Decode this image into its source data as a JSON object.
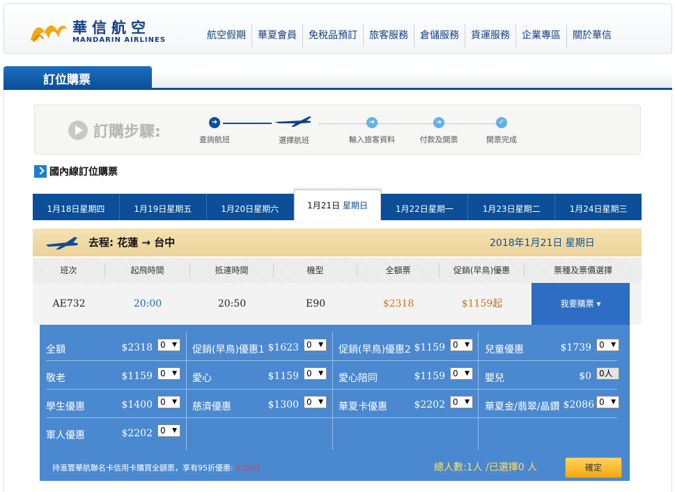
{
  "brand": {
    "name_cn": "華信航空",
    "name_en": "MANDARIN AIRLINES",
    "color": "#123f86"
  },
  "nav": [
    "航空假期",
    "華夏會員",
    "免稅品預訂",
    "旅客服務",
    "倉儲服務",
    "貨運服務",
    "企業專區",
    "關於華信"
  ],
  "section_title": "訂位購票",
  "steps": {
    "title": "訂購步驟:",
    "items": [
      {
        "label": "查詢航班",
        "state": "done"
      },
      {
        "label": "選擇航班",
        "state": "current"
      },
      {
        "label": "輸入旅客資料",
        "state": "todo"
      },
      {
        "label": "付款及開票",
        "state": "todo"
      },
      {
        "label": "開票完成",
        "state": "todo"
      }
    ]
  },
  "subheading": "國內線訂位購票",
  "date_tabs": [
    {
      "date": "1月18日",
      "dow": "星期四"
    },
    {
      "date": "1月19日",
      "dow": "星期五"
    },
    {
      "date": "1月20日",
      "dow": "星期六"
    },
    {
      "date": "1月21日",
      "dow": "星期日",
      "active": true
    },
    {
      "date": "1月22日",
      "dow": "星期一"
    },
    {
      "date": "1月23日",
      "dow": "星期二"
    },
    {
      "date": "1月24日",
      "dow": "星期三"
    }
  ],
  "route": {
    "label": "去程: 花蓮 → 台中",
    "date": "2018年1月21日 星期日"
  },
  "table": {
    "headers": [
      "班次",
      "起飛時間",
      "抵達時間",
      "機型",
      "全額票",
      "促銷(早鳥)優惠",
      "票種及票價選擇"
    ],
    "row": {
      "flight": "AE732",
      "depart": "20:00",
      "arrive": "20:50",
      "aircraft": "E90",
      "full_fare": "$2318",
      "promo_fare": "$1159起",
      "action": "我要購票 ▾"
    }
  },
  "fares": [
    [
      {
        "name": "全額",
        "price": "$2318",
        "qty": "0"
      },
      {
        "name": "促銷(早鳥)優惠1",
        "price": "$1623",
        "qty": "0"
      },
      {
        "name": "促銷(早鳥)優惠2",
        "price": "$1159",
        "qty": "0"
      },
      {
        "name": "兒童優惠",
        "price": "$1739",
        "qty": "0"
      }
    ],
    [
      {
        "name": "敬老",
        "price": "$1159",
        "qty": "0"
      },
      {
        "name": "愛心",
        "price": "$1159",
        "qty": "0"
      },
      {
        "name": "愛心陪同",
        "price": "$1159",
        "qty": "0"
      },
      {
        "name": "嬰兒",
        "price": "$0",
        "qty": "0人",
        "plain": true
      }
    ],
    [
      {
        "name": "學生優惠",
        "price": "$1400",
        "qty": "0"
      },
      {
        "name": "慈濟優惠",
        "price": "$1300",
        "qty": "0"
      },
      {
        "name": "華夏卡優惠",
        "price": "$2202",
        "qty": "0"
      },
      {
        "name": "華夏金/翡翠/晶鑽",
        "price": "$2086",
        "qty": "0"
      }
    ],
    [
      {
        "name": "軍人優惠",
        "price": "$2202",
        "qty": "0"
      }
    ]
  ],
  "footer": {
    "promo_text": "持滙豐華航聯名卡信用卡購買全額票，享有95折優惠: ",
    "promo_amount": "$2202",
    "count": "總人數:1人 /已選擇0 人",
    "confirm": "確定"
  }
}
